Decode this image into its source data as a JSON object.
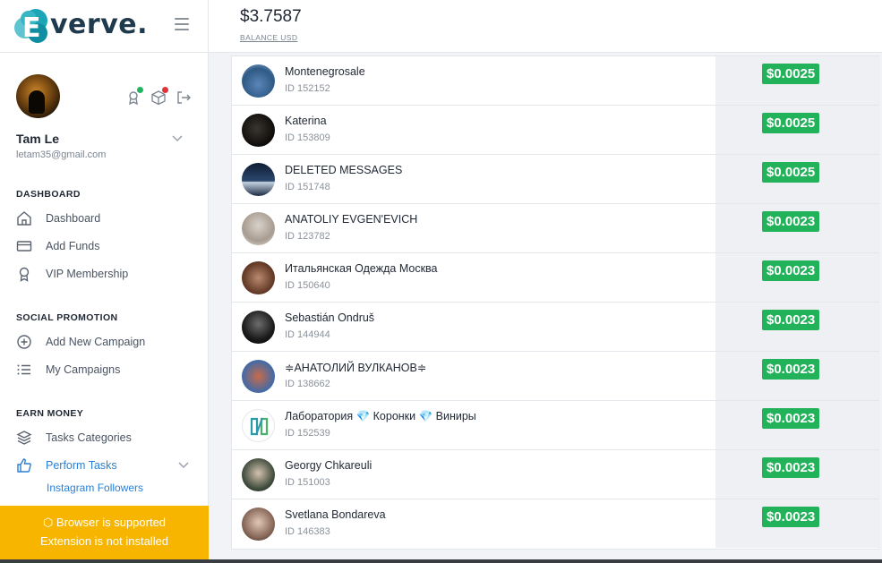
{
  "brand": {
    "logo_letter": "E",
    "logo_rest": "verve."
  },
  "balance": {
    "amount": "$3.7587",
    "label": "BALANCE USD"
  },
  "user": {
    "name": "Tam Le",
    "email": "letam35@gmail.com"
  },
  "nav": {
    "dashboard_section": "DASHBOARD",
    "dashboard": "Dashboard",
    "add_funds": "Add Funds",
    "vip": "VIP Membership",
    "social_section": "SOCIAL PROMOTION",
    "add_campaign": "Add New Campaign",
    "my_campaigns": "My Campaigns",
    "earn_section": "EARN MONEY",
    "task_categories": "Tasks Categories",
    "perform_tasks": "Perform Tasks",
    "instagram_followers": "Instagram Followers"
  },
  "banner": {
    "line1": "Browser is supported",
    "line2": "Extension is not installed"
  },
  "colors": {
    "accent_green": "#21b25a",
    "banner_yellow": "#f7b500",
    "link_blue": "#2a7fd4"
  },
  "tasks": [
    {
      "name": "Montenegrosale",
      "id": "ID 152152",
      "price": "$0.0025"
    },
    {
      "name": "Katerina",
      "id": "ID 153809",
      "price": "$0.0025"
    },
    {
      "name": "DELETED MESSAGES",
      "id": "ID 151748",
      "price": "$0.0025"
    },
    {
      "name": "ANATOLIY EVGEN'EVICH",
      "id": "ID 123782",
      "price": "$0.0023"
    },
    {
      "name": "Итальянская Одежда Москва",
      "id": "ID 150640",
      "price": "$0.0023"
    },
    {
      "name": "Sebastián Ondruš",
      "id": "ID 144944",
      "price": "$0.0023"
    },
    {
      "name": "≑АНАТОЛИЙ ВУЛКАНОВ≑",
      "id": "ID 138662",
      "price": "$0.0023"
    },
    {
      "name": "Лаборатория 💎 Коронки 💎 Виниры",
      "id": "ID 152539",
      "price": "$0.0023"
    },
    {
      "name": "Georgy Chkareuli",
      "id": "ID 151003",
      "price": "$0.0023"
    },
    {
      "name": "Svetlana Bondareva",
      "id": "ID 146383",
      "price": "$0.0023"
    }
  ]
}
